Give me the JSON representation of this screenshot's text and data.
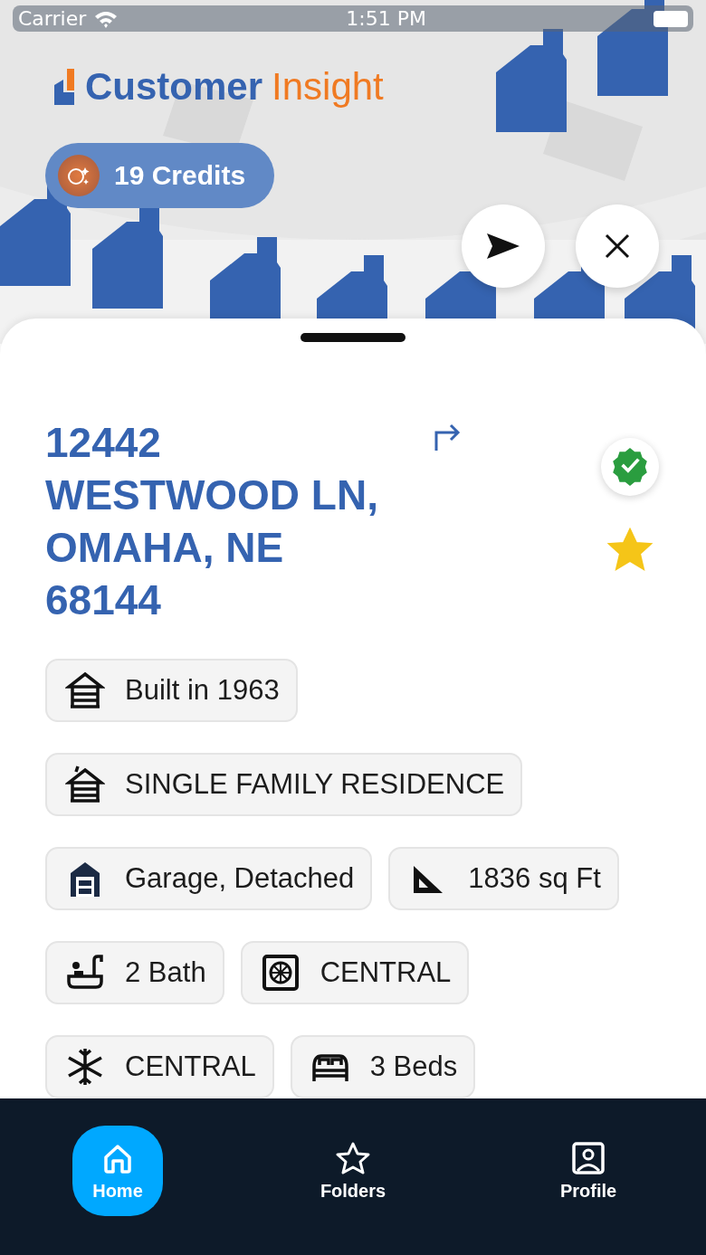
{
  "status_bar": {
    "carrier": "Carrier",
    "time": "1:51 PM"
  },
  "logo": {
    "first": "Customer",
    "second": "Insight"
  },
  "credits": {
    "label": "19 Credits"
  },
  "property": {
    "address_lines": [
      "12442",
      "WESTWOOD LN,",
      "OMAHA, NE",
      "68144"
    ],
    "verified": true,
    "favorite": true
  },
  "features": [
    {
      "kind": "built",
      "label": "Built in 1963"
    },
    {
      "kind": "property_type",
      "label": "SINGLE FAMILY RESIDENCE"
    },
    {
      "kind": "garage",
      "label": "Garage, Detached"
    },
    {
      "kind": "area",
      "label": "1836 sq Ft"
    },
    {
      "kind": "bath",
      "label": "2 Bath"
    },
    {
      "kind": "heating",
      "label": "CENTRAL"
    },
    {
      "kind": "cooling",
      "label": "CENTRAL"
    },
    {
      "kind": "beds",
      "label": "3 Beds"
    }
  ],
  "nav": [
    {
      "kind": "home",
      "label": "Home",
      "selected": true
    },
    {
      "kind": "folders",
      "label": "Folders",
      "selected": false
    },
    {
      "kind": "profile",
      "label": "Profile",
      "selected": false
    }
  ]
}
